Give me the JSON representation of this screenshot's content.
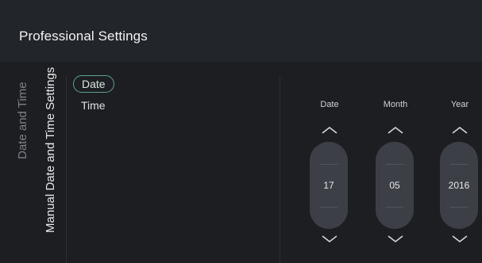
{
  "header": {
    "title": "Professional Settings"
  },
  "breadcrumb": {
    "parent": "Date and Time",
    "current": "Manual Date and Time Settings"
  },
  "menu": {
    "items": [
      {
        "label": "Date",
        "selected": true
      },
      {
        "label": "Time",
        "selected": false
      }
    ]
  },
  "pickers": [
    {
      "label": "Date",
      "value": "17"
    },
    {
      "label": "Month",
      "value": "05"
    },
    {
      "label": "Year",
      "value": "2016"
    }
  ],
  "colors": {
    "background": "#1c1e22",
    "header": "#22252a",
    "accent": "#5fa392",
    "pill": "#3c3f45"
  },
  "icons": {
    "up": "chevron-up-icon",
    "down": "chevron-down-icon"
  }
}
